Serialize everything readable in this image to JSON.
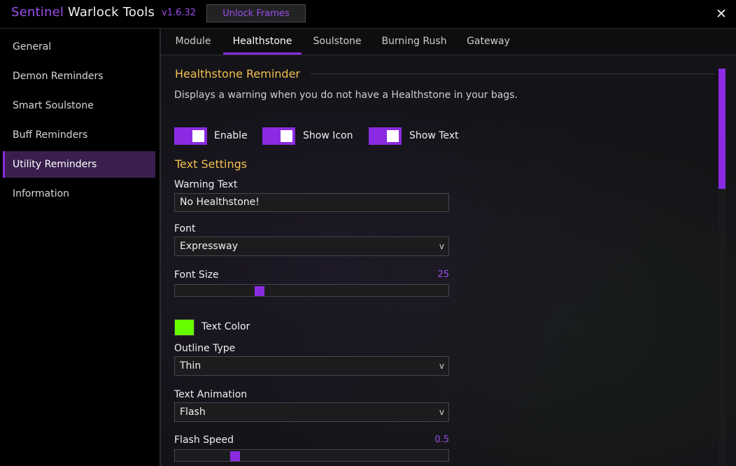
{
  "app": {
    "brand": "Sentinel",
    "title_rest": " Warlock Tools",
    "version": "v1.6.32",
    "unlock_button": "Unlock Frames",
    "close_glyph": "✕"
  },
  "sidebar": {
    "items": [
      {
        "label": "General"
      },
      {
        "label": "Demon Reminders"
      },
      {
        "label": "Smart Soulstone"
      },
      {
        "label": "Buff Reminders"
      },
      {
        "label": "Utility Reminders",
        "active": true
      },
      {
        "label": "Information"
      }
    ]
  },
  "tabs": [
    {
      "label": "Module"
    },
    {
      "label": "Healthstone",
      "active": true
    },
    {
      "label": "Soulstone"
    },
    {
      "label": "Burning Rush"
    },
    {
      "label": "Gateway"
    }
  ],
  "section": {
    "title": "Healthstone Reminder",
    "description": "Displays a warning when you do not have a Healthstone in your bags.",
    "toggles": [
      {
        "label": "Enable",
        "on": true
      },
      {
        "label": "Show Icon",
        "on": true
      },
      {
        "label": "Show Text",
        "on": true
      }
    ]
  },
  "text_settings": {
    "title": "Text Settings",
    "warning_text": {
      "label": "Warning Text",
      "value": "No Healthstone!"
    },
    "font": {
      "label": "Font",
      "value": "Expressway"
    },
    "font_size": {
      "label": "Font Size",
      "value": "25",
      "fraction": 0.31
    },
    "text_color": {
      "label": "Text Color",
      "color": "#66ff00"
    },
    "outline_type": {
      "label": "Outline Type",
      "value": "Thin"
    },
    "text_animation": {
      "label": "Text Animation",
      "value": "Flash"
    },
    "flash_speed": {
      "label": "Flash Speed",
      "value": "0.5",
      "fraction": 0.22
    }
  },
  "colors": {
    "accent": "#8a2be2",
    "heading": "#f2c14e"
  },
  "icons": {
    "dropdown": "chevron-down-icon",
    "close": "close-icon"
  }
}
